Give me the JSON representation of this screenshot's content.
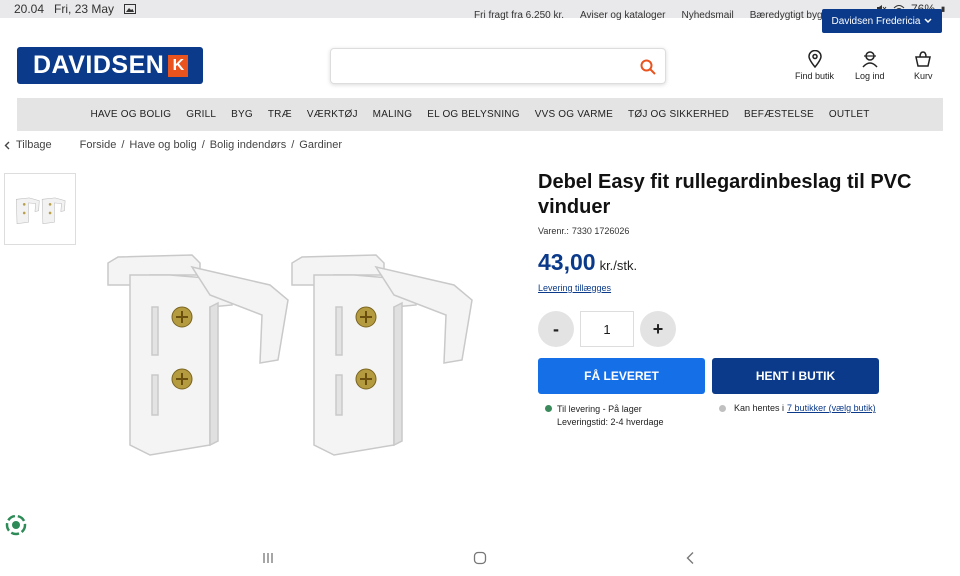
{
  "status_bar": {
    "time": "20.04",
    "date": "Fri, 23 May",
    "battery": "76%"
  },
  "top_strip": {
    "links": [
      "Fri fragt fra 6.250 kr.",
      "Aviser og kataloger",
      "Nyhedsmail",
      "Bæredygtigt byggeri"
    ],
    "store_button": "Davidsen Fredericia"
  },
  "header": {
    "logo_text": "DAVIDSEN",
    "logo_mark": "K",
    "search_placeholder": "",
    "actions": [
      "Find butik",
      "Log ind",
      "Kurv"
    ]
  },
  "nav": {
    "items": [
      "HAVE OG BOLIG",
      "GRILL",
      "BYG",
      "TRÆ",
      "VÆRKTØJ",
      "MALING",
      "EL OG BELYSNING",
      "VVS OG VARME",
      "TØJ OG SIKKERHED",
      "BEFÆSTELSE",
      "OUTLET"
    ]
  },
  "breadcrumb": {
    "back_label": "Tilbage",
    "items": [
      "Forside",
      "Have og bolig",
      "Bolig indendørs",
      "Gardiner"
    ],
    "separator": "/"
  },
  "product": {
    "title": "Debel Easy fit rullegardinbeslag til PVC vinduer",
    "sku_label": "Varenr.:",
    "sku": "7330 1726026",
    "price": "43,00",
    "price_unit": "kr./stk.",
    "delivery_link": "Levering tillægges",
    "quantity": "1",
    "minus_label": "-",
    "plus_label": "+",
    "btn_deliver": "FÅ LEVERET",
    "btn_pickup": "HENT I BUTIK",
    "delivery_status_line1": "Til levering - På lager",
    "delivery_status_line2": "Leveringstid: 2-4 hverdage",
    "pickup_status_prefix": "Kan hentes i",
    "pickup_status_link": "7 butikker (vælg butik)"
  },
  "colors": {
    "brand_blue": "#0b3a8a",
    "accent_blue": "#1570e8",
    "logo_orange": "#e8531e",
    "in_stock_green": "#3a8a5c",
    "unavailable_grey": "#c0c0c0"
  }
}
